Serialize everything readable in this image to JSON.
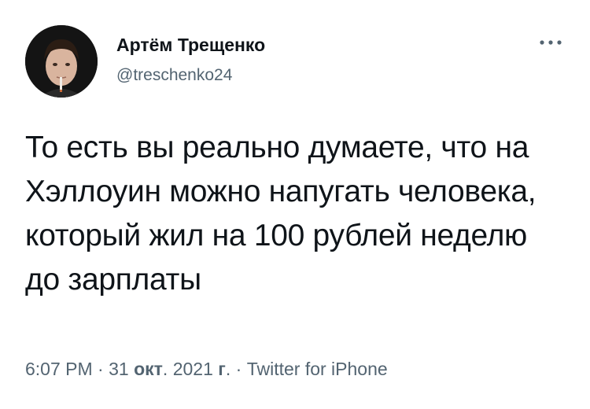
{
  "author": {
    "display_name": "Артём Трещенко",
    "handle": "@treschenko24"
  },
  "tweet": {
    "text": "То есть вы реально думаете, что на Хэллоуин можно напугать человека, который жил на 100 рублей неделю до зарплаты"
  },
  "meta": {
    "time": "6:07 PM",
    "sep1": " · ",
    "day": "31 ",
    "month": "окт",
    "year": ". 2021 ",
    "year_suffix": "г",
    "sep_dot": ". ",
    "sep2": "· ",
    "source": "Twitter for iPhone"
  },
  "icons": {
    "more": "more-horizontal-icon",
    "avatar": "profile-photo"
  },
  "colors": {
    "text_primary": "#0f1419",
    "text_secondary": "#536471",
    "background": "#ffffff"
  }
}
